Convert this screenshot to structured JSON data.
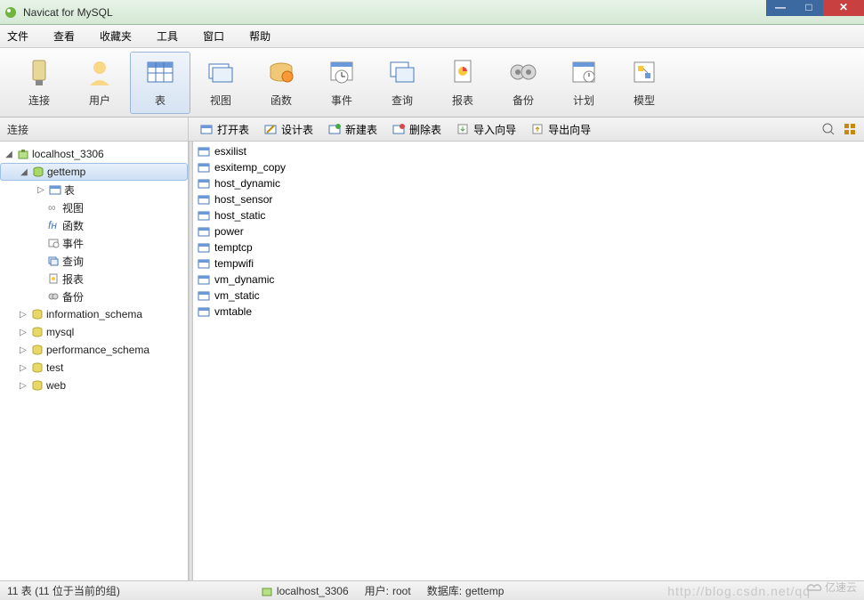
{
  "app": {
    "title": "Navicat for MySQL"
  },
  "menu": {
    "file": "文件",
    "view": "查看",
    "fav": "收藏夹",
    "tools": "工具",
    "window": "窗口",
    "help": "帮助"
  },
  "toolbar": {
    "connect": "连接",
    "user": "用户",
    "table": "表",
    "view": "视图",
    "function": "函数",
    "event": "事件",
    "query": "查询",
    "report": "报表",
    "backup": "备份",
    "schedule": "计划",
    "model": "模型"
  },
  "section": {
    "left": "连接",
    "open": "打开表",
    "design": "设计表",
    "new": "新建表",
    "delete": "删除表",
    "import": "导入向导",
    "export": "导出向导"
  },
  "tree": {
    "conn": "localhost_3306",
    "db_sel": "gettemp",
    "nodes": {
      "table": "表",
      "view": "视图",
      "func": "函数",
      "event": "事件",
      "query": "查询",
      "report": "报表",
      "backup": "备份"
    },
    "dbs": [
      "information_schema",
      "mysql",
      "performance_schema",
      "test",
      "web"
    ]
  },
  "tables": [
    "esxilist",
    "esxitemp_copy",
    "host_dynamic",
    "host_sensor",
    "host_static",
    "power",
    "temptcp",
    "tempwifi",
    "vm_dynamic",
    "vm_static",
    "vmtable"
  ],
  "status": {
    "count": "11 表 (11 位于当前的组)",
    "conn": "localhost_3306",
    "user_label": "用户: ",
    "user": "root",
    "db_label": "数据库: ",
    "db": "gettemp"
  },
  "watermark": "http://blog.csdn.net/qq",
  "brand": "亿速云"
}
